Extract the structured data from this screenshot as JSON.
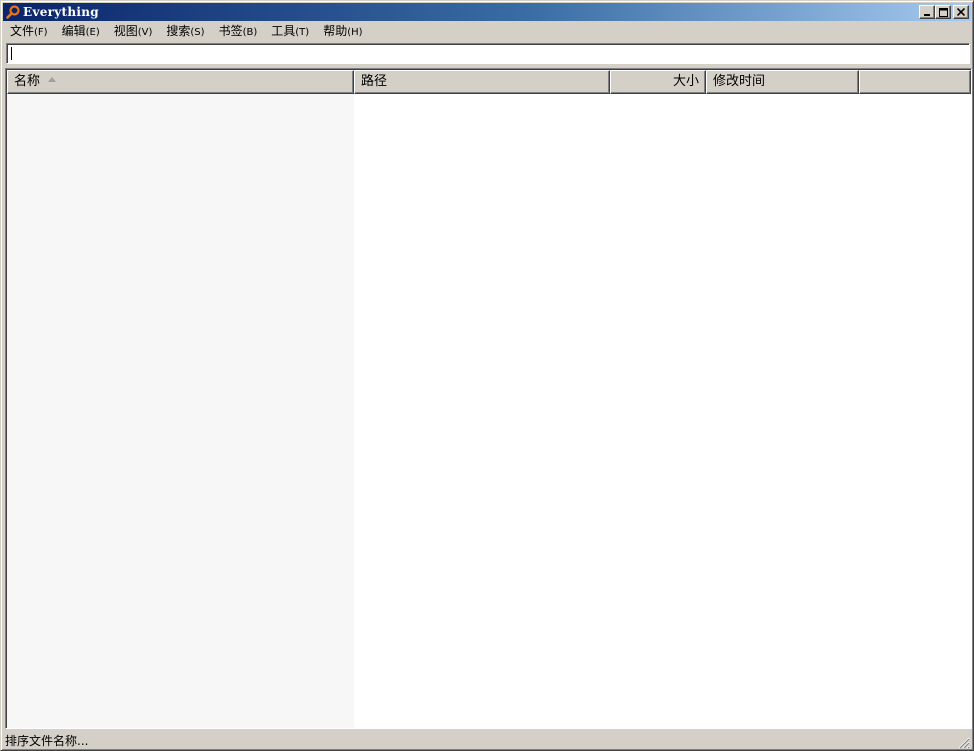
{
  "window": {
    "title": "Everything",
    "icon": "magnifier-icon",
    "controls": {
      "minimize_glyph": "_",
      "maximize_glyph": "□",
      "close_glyph": "✕"
    }
  },
  "menubar": {
    "items": [
      {
        "label": "文件",
        "accel": "(F)"
      },
      {
        "label": "编辑",
        "accel": "(E)"
      },
      {
        "label": "视图",
        "accel": "(V)"
      },
      {
        "label": "搜索",
        "accel": "(S)"
      },
      {
        "label": "书签",
        "accel": "(B)"
      },
      {
        "label": "工具",
        "accel": "(T)"
      },
      {
        "label": "帮助",
        "accel": "(H)"
      }
    ]
  },
  "search": {
    "value": "",
    "placeholder": ""
  },
  "list": {
    "columns": [
      {
        "label": "名称",
        "sorted": "ascending"
      },
      {
        "label": "路径"
      },
      {
        "label": "大小"
      },
      {
        "label": "修改时间"
      },
      {
        "label": ""
      }
    ],
    "rows": []
  },
  "statusbar": {
    "text": "排序文件名称..."
  },
  "colors": {
    "title_gradient_start": "#0a246a",
    "title_gradient_end": "#a6caf0",
    "face": "#d4d0c8",
    "name_column_bg": "#f7f7f7",
    "icon_orange": "#e8731a"
  }
}
